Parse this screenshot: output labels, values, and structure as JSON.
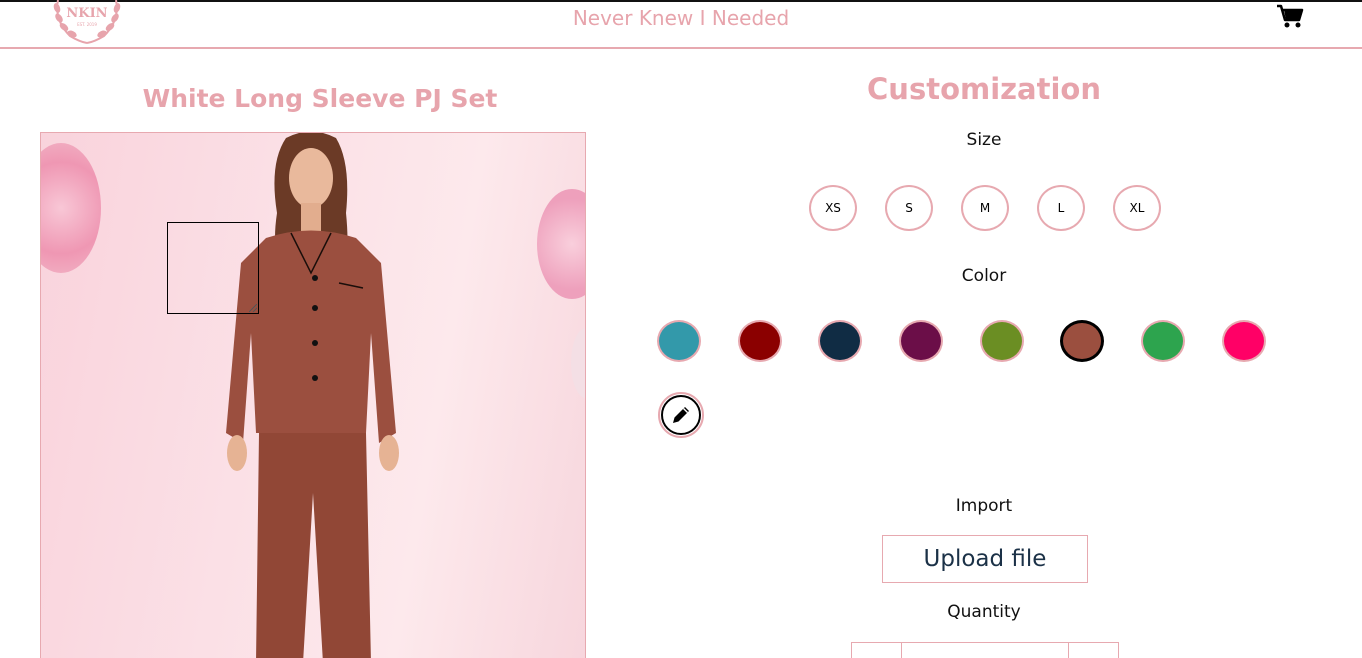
{
  "header": {
    "logo_text": "NKIN",
    "logo_sub": "EST. 2019",
    "tagline": "Never Knew I Needed",
    "cart_icon": "cart-icon"
  },
  "product": {
    "title": "White Long Sleeve PJ Set"
  },
  "customization": {
    "title": "Customization",
    "size_label": "Size",
    "sizes": [
      "XS",
      "S",
      "M",
      "L",
      "XL"
    ],
    "color_label": "Color",
    "colors": [
      "#3399aa",
      "#8b0000",
      "#102c44",
      "#6b0e48",
      "#6b8e23",
      "#9b4f3f",
      "#2da44e",
      "#ff0066"
    ],
    "selected_color": "#9b4f3f",
    "pencil_icon": "pencil-icon",
    "import_label": "Import",
    "upload_label": "Upload file",
    "quantity_label": "Quantity"
  }
}
